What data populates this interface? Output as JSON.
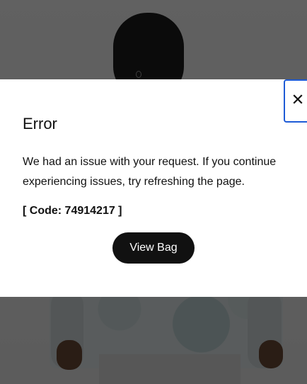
{
  "dialog": {
    "title": "Error",
    "message": "We had an issue with your request. If you continue experiencing issues, try refreshing the page.",
    "code": "[ Code: 74914217 ]",
    "primary_button_label": "View Bag",
    "close_icon": "close-icon"
  },
  "colors": {
    "focus_ring": "#1e5bd6",
    "button_bg": "#111111",
    "button_text": "#ffffff"
  }
}
